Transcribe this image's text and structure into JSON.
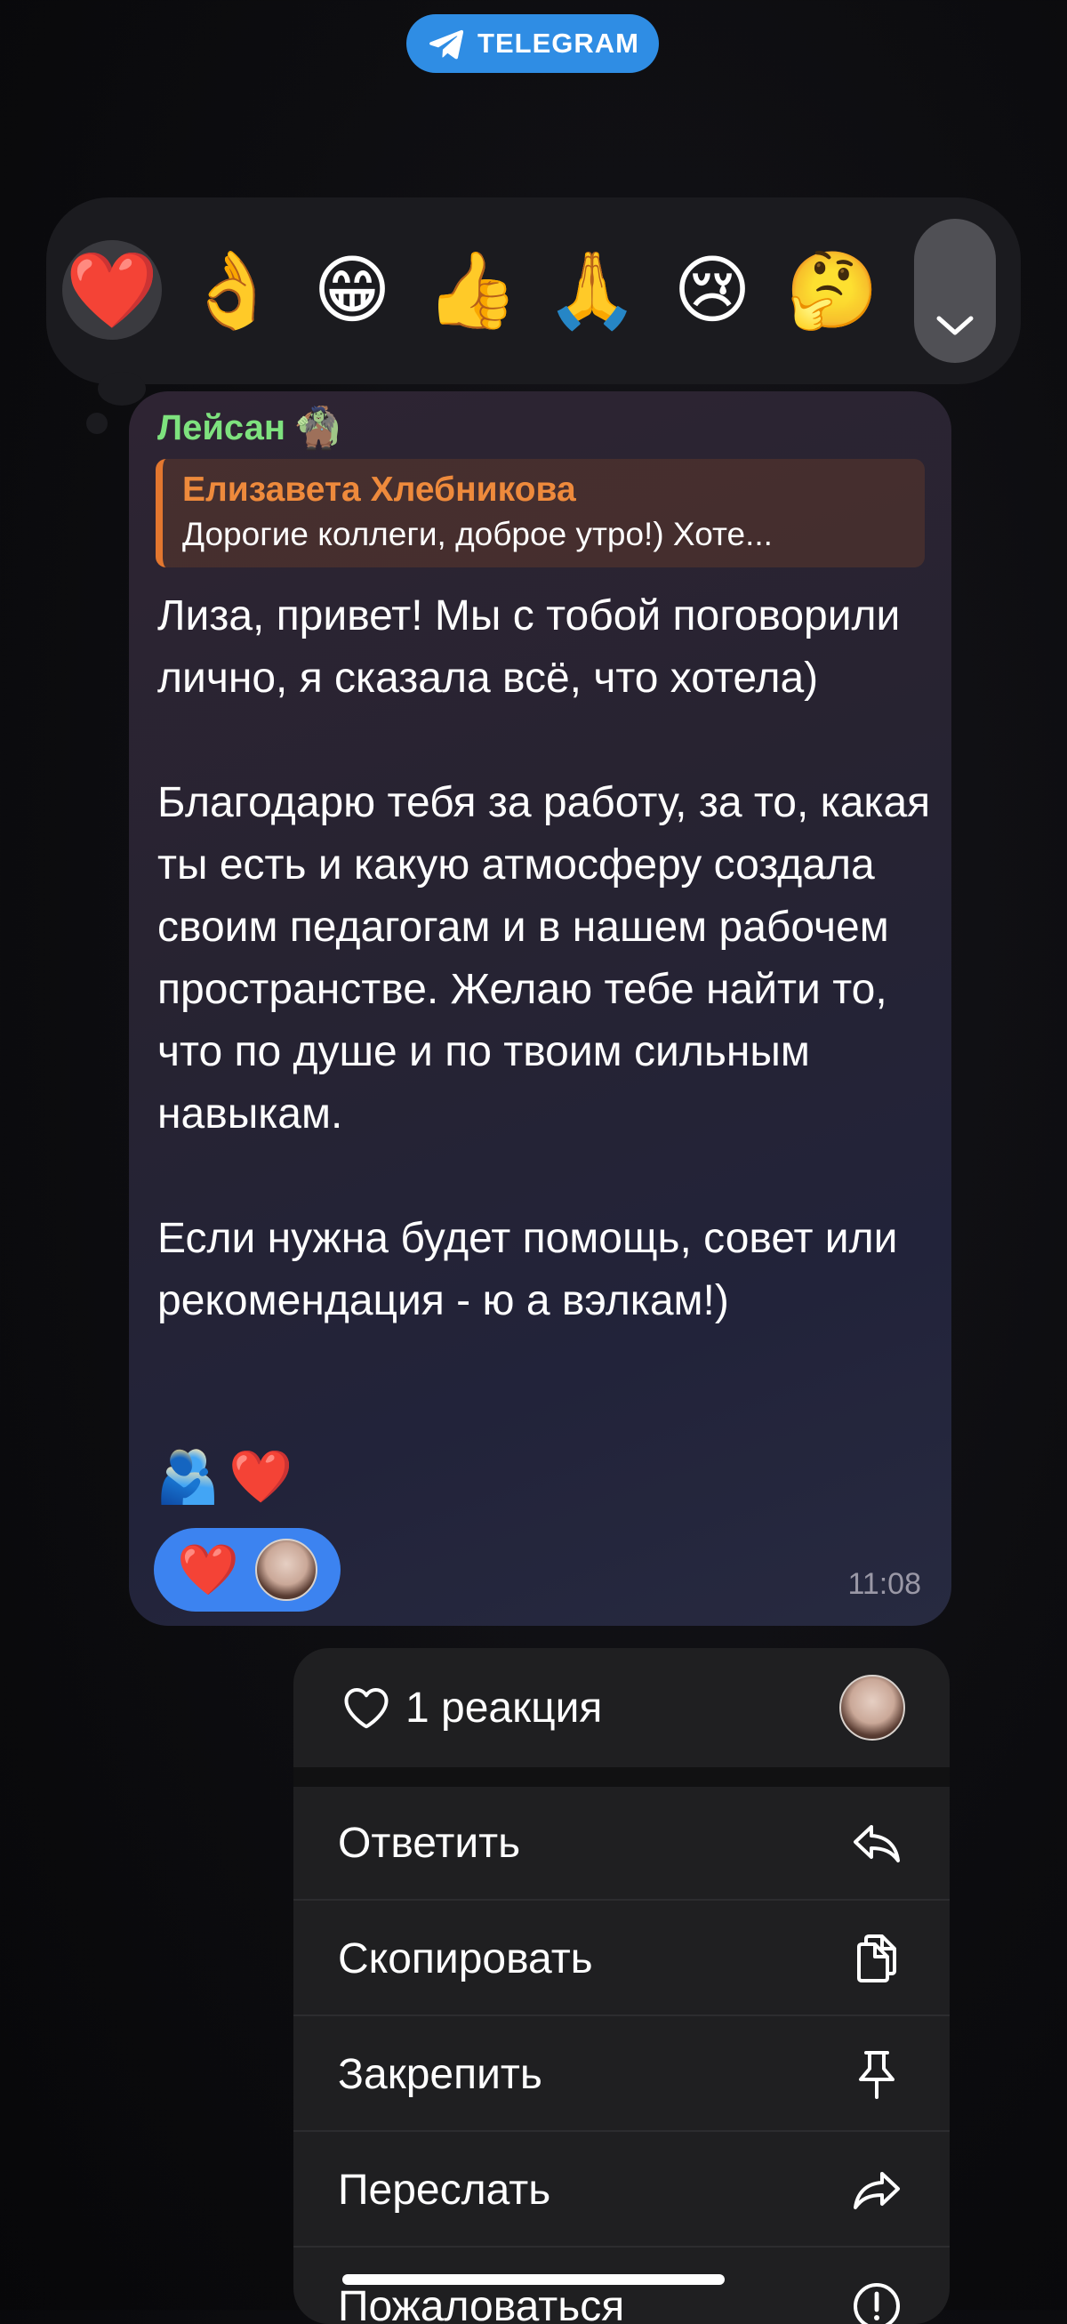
{
  "badge": {
    "label": "TELEGRAM",
    "color": "#2f8de4"
  },
  "reaction_bar": {
    "reactions": [
      "❤️",
      "👌",
      "😁",
      "👍",
      "🙏",
      "😢",
      "🤔"
    ],
    "selected_index": 0,
    "expand_icon": "chevron-down-icon"
  },
  "message": {
    "sender": "Лейсан",
    "sender_emoji": "🧌",
    "reply": {
      "author": "Елизавета Хлебникова",
      "text": "Дорогие коллеги, доброе утро!) Хоте..."
    },
    "paragraphs": [
      "Лиза, привет! Мы с тобой поговорили лично, я сказала всё, что хотела)",
      "Благодарю тебя за работу, за то, какая ты есть и какую атмосферу создала своим педагогам и в нашем рабочем пространстве. Желаю тебе найти то, что по душе и по твоим сильным навыкам.",
      "Если нужна будет помощь, совет или рекомендация - ю а вэлкам!)"
    ],
    "inline_emojis": [
      "🫂",
      "❤️"
    ],
    "reaction_pill": {
      "emoji": "❤️"
    },
    "time": "11:08"
  },
  "context_menu": {
    "reactions_label": "1 реакция",
    "items": [
      {
        "label": "Ответить",
        "icon": "reply-icon"
      },
      {
        "label": "Скопировать",
        "icon": "copy-icon"
      },
      {
        "label": "Закрепить",
        "icon": "pin-icon"
      },
      {
        "label": "Переслать",
        "icon": "forward-icon"
      },
      {
        "label": "Пожаловаться",
        "icon": "report-icon"
      }
    ]
  },
  "colors": {
    "sender_name": "#7ee27e",
    "reply_accent": "#e3772f",
    "reaction_pill": "#3c83f0"
  }
}
